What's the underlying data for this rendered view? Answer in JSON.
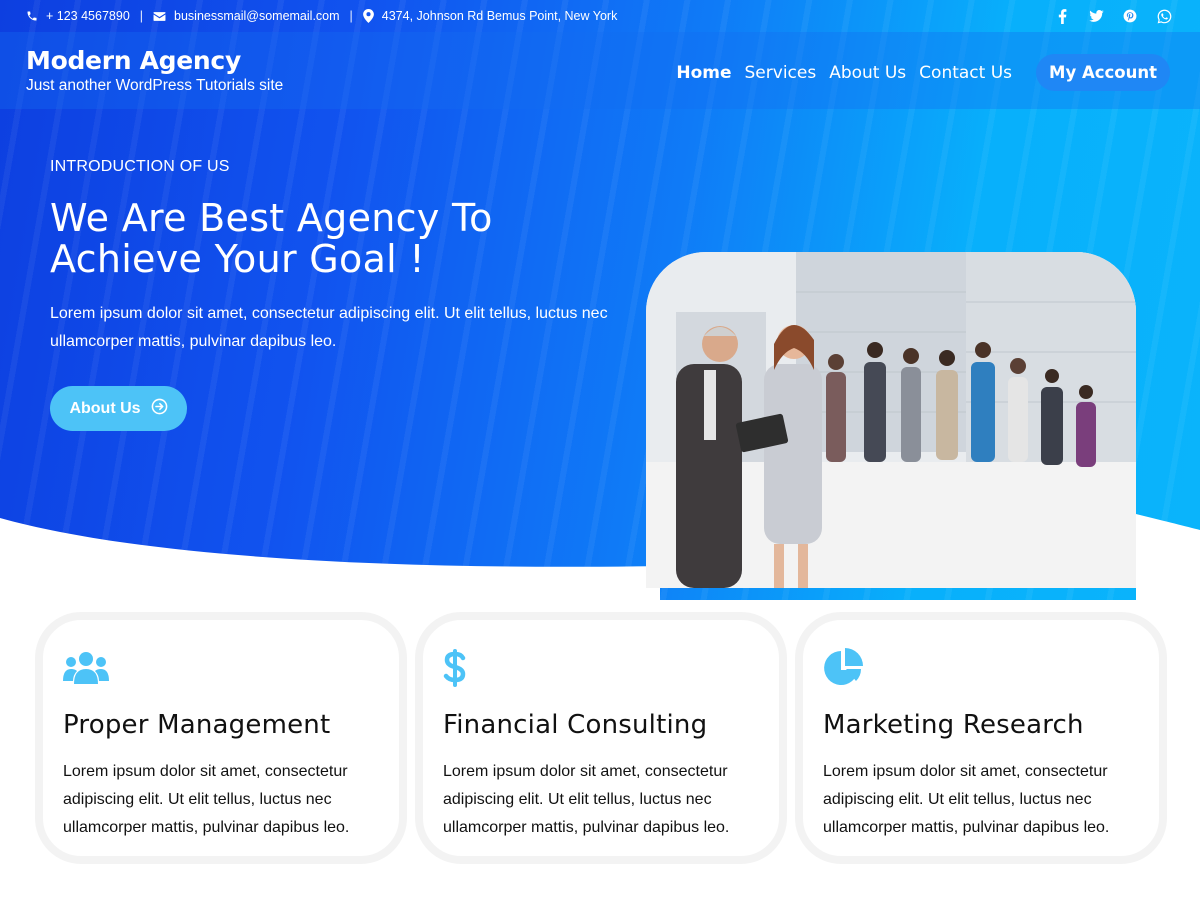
{
  "topbar": {
    "phone": "+ 123 4567890",
    "email": "businessmail@somemail.com",
    "address": "4374, Johnson Rd Bemus Point, New York",
    "social": [
      "facebook-icon",
      "twitter-icon",
      "pinterest-icon",
      "whatsapp-icon"
    ]
  },
  "brand": {
    "name": "Modern Agency",
    "tagline": "Just another WordPress Tutorials site"
  },
  "nav": {
    "items": [
      "Home",
      "Services",
      "About Us",
      "Contact Us"
    ],
    "active": "Home",
    "account": "My Account"
  },
  "hero": {
    "eyebrow": "INTRODUCTION OF US",
    "headline_line1": "We Are Best Agency To",
    "headline_line2": "Achieve Your Goal !",
    "intro_line1": "Lorem ipsum dolor sit amet, consectetur adipiscing elit. Ut elit tellus, luctus nec",
    "intro_line2": "ullamcorper mattis, pulvinar dapibus leo.",
    "button": "About Us"
  },
  "features": [
    {
      "icon": "users-icon",
      "title": "Proper Management",
      "text_line1": "Lorem ipsum dolor sit amet, consectetur",
      "text_line2": "adipiscing elit. Ut elit tellus, luctus nec",
      "text_line3": "ullamcorper mattis, pulvinar dapibus leo."
    },
    {
      "icon": "dollar-icon",
      "title": "Financial Consulting",
      "text_line1": "Lorem ipsum dolor sit amet, consectetur",
      "text_line2": "adipiscing elit. Ut elit tellus, luctus nec",
      "text_line3": "ullamcorper mattis, pulvinar dapibus leo."
    },
    {
      "icon": "pie-chart-icon",
      "title": "Marketing Research",
      "text_line1": "Lorem ipsum dolor sit amet, consectetur",
      "text_line2": "adipiscing elit. Ut elit tellus, luctus nec",
      "text_line3": "ullamcorper mattis, pulvinar dapibus leo."
    }
  ],
  "colors": {
    "accent": "#4dc3f7",
    "gradient_start": "#0d3fe0",
    "gradient_end": "#0ab4fb",
    "account_button": "#1f87f5"
  }
}
